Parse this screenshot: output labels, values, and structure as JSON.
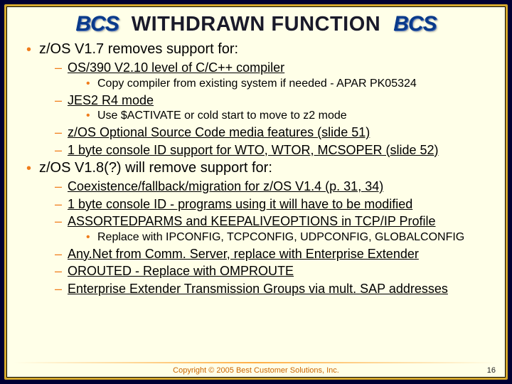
{
  "logo": "BCS",
  "title": "WITHDRAWN FUNCTION",
  "s1": {
    "head": "z/OS V1.7 removes support for:",
    "a": "OS/390 V2.10 level of C/C++ compiler",
    "a1": "Copy compiler from existing system if needed - APAR PK05324",
    "b": "JES2 R4 mode",
    "b1": "Use $ACTIVATE or cold start to move to z2 mode",
    "c": "z/OS Optional Source Code media features (slide 51)",
    "d": "1 byte console ID support for WTO, WTOR, MCSOPER (slide 52)"
  },
  "s2": {
    "head": "z/OS V1.8(?) will remove support for:",
    "a": "Coexistence/fallback/migration for z/OS V1.4 (p. 31, 34)",
    "b": "1 byte console ID - programs using it will have to be modified",
    "c": "ASSORTEDPARMS and KEEPALIVEOPTIONS in TCP/IP Profile",
    "c1": "Replace with IPCONFIG, TCPCONFIG, UDPCONFIG, GLOBALCONFIG",
    "d": "Any.Net from Comm. Server, replace with Enterprise Extender",
    "e": "OROUTED - Replace with OMPROUTE",
    "f": "Enterprise Extender Transmission Groups via mult. SAP addresses"
  },
  "footer": "Copyright © 2005 Best Customer Solutions, Inc.",
  "page": "16"
}
